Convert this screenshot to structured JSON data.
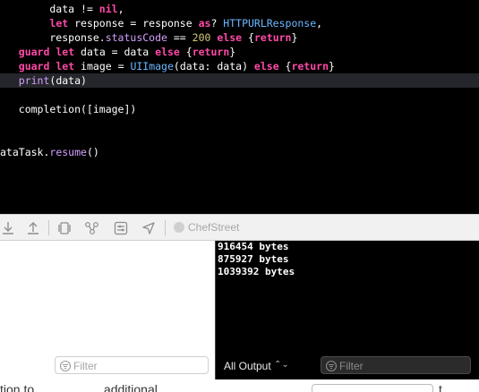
{
  "editor": {
    "lines": [
      [
        [
          "pl",
          "        data "
        ],
        [
          "pl",
          "!= "
        ],
        [
          "kw",
          "nil"
        ],
        [
          "pl",
          ","
        ]
      ],
      [
        [
          "pl",
          "        "
        ],
        [
          "kw",
          "let"
        ],
        [
          "pl",
          " response = response "
        ],
        [
          "kw",
          "as"
        ],
        [
          "pl",
          "? "
        ],
        [
          "type",
          "HTTPURLResponse"
        ],
        [
          "pl",
          ","
        ]
      ],
      [
        [
          "pl",
          "        response."
        ],
        [
          "prop",
          "statusCode"
        ],
        [
          "pl",
          " == "
        ],
        [
          "num",
          "200"
        ],
        [
          "pl",
          " "
        ],
        [
          "kw",
          "else"
        ],
        [
          "pl",
          " {"
        ],
        [
          "kw",
          "return"
        ],
        [
          "pl",
          "}"
        ]
      ],
      [
        [
          "pl",
          "   "
        ],
        [
          "kw",
          "guard"
        ],
        [
          "pl",
          " "
        ],
        [
          "kw",
          "let"
        ],
        [
          "pl",
          " data = data "
        ],
        [
          "kw",
          "else"
        ],
        [
          "pl",
          " {"
        ],
        [
          "kw",
          "return"
        ],
        [
          "pl",
          "}"
        ]
      ],
      [
        [
          "pl",
          "   "
        ],
        [
          "kw",
          "guard"
        ],
        [
          "pl",
          " "
        ],
        [
          "kw",
          "let"
        ],
        [
          "pl",
          " image = "
        ],
        [
          "type",
          "UIImage"
        ],
        [
          "pl",
          "(data: data) "
        ],
        [
          "kw",
          "else"
        ],
        [
          "pl",
          " {"
        ],
        [
          "kw",
          "return"
        ],
        [
          "pl",
          "}"
        ]
      ],
      [
        [
          "pl",
          "   "
        ],
        [
          "fn",
          "print"
        ],
        [
          "pl",
          "(data)"
        ]
      ],
      [
        [
          "pl",
          ""
        ]
      ],
      [
        [
          "pl",
          "   completion([image])"
        ]
      ],
      [
        [
          "pl",
          ""
        ]
      ],
      [
        [
          "pl",
          ""
        ]
      ],
      [
        [
          "pl",
          "ataTask."
        ],
        [
          "fn",
          "resume"
        ],
        [
          "pl",
          "()"
        ]
      ]
    ],
    "highlighted_line": 5
  },
  "debug_bar": {
    "process_name": "ChefStreet",
    "icons": [
      "step-into-icon",
      "step-out-icon",
      "view-hierarchy-icon",
      "memory-graph-icon",
      "environment-overrides-icon",
      "simulate-location-icon",
      "process-icon"
    ]
  },
  "console": {
    "output": [
      "916454 bytes",
      "875927 bytes",
      "1039392 bytes"
    ],
    "output_selector": "All Output",
    "filter_placeholder": "Filter"
  },
  "variables": {
    "filter_placeholder": "Filter"
  },
  "bottom": {
    "text_left": "tion to                    additional            ",
    "box_text": "",
    "text_right": "t"
  },
  "colors": {
    "keyword": "#ff4aa8",
    "type": "#6ab7ff",
    "number": "#d9c97c",
    "function": "#d3a0ff"
  }
}
